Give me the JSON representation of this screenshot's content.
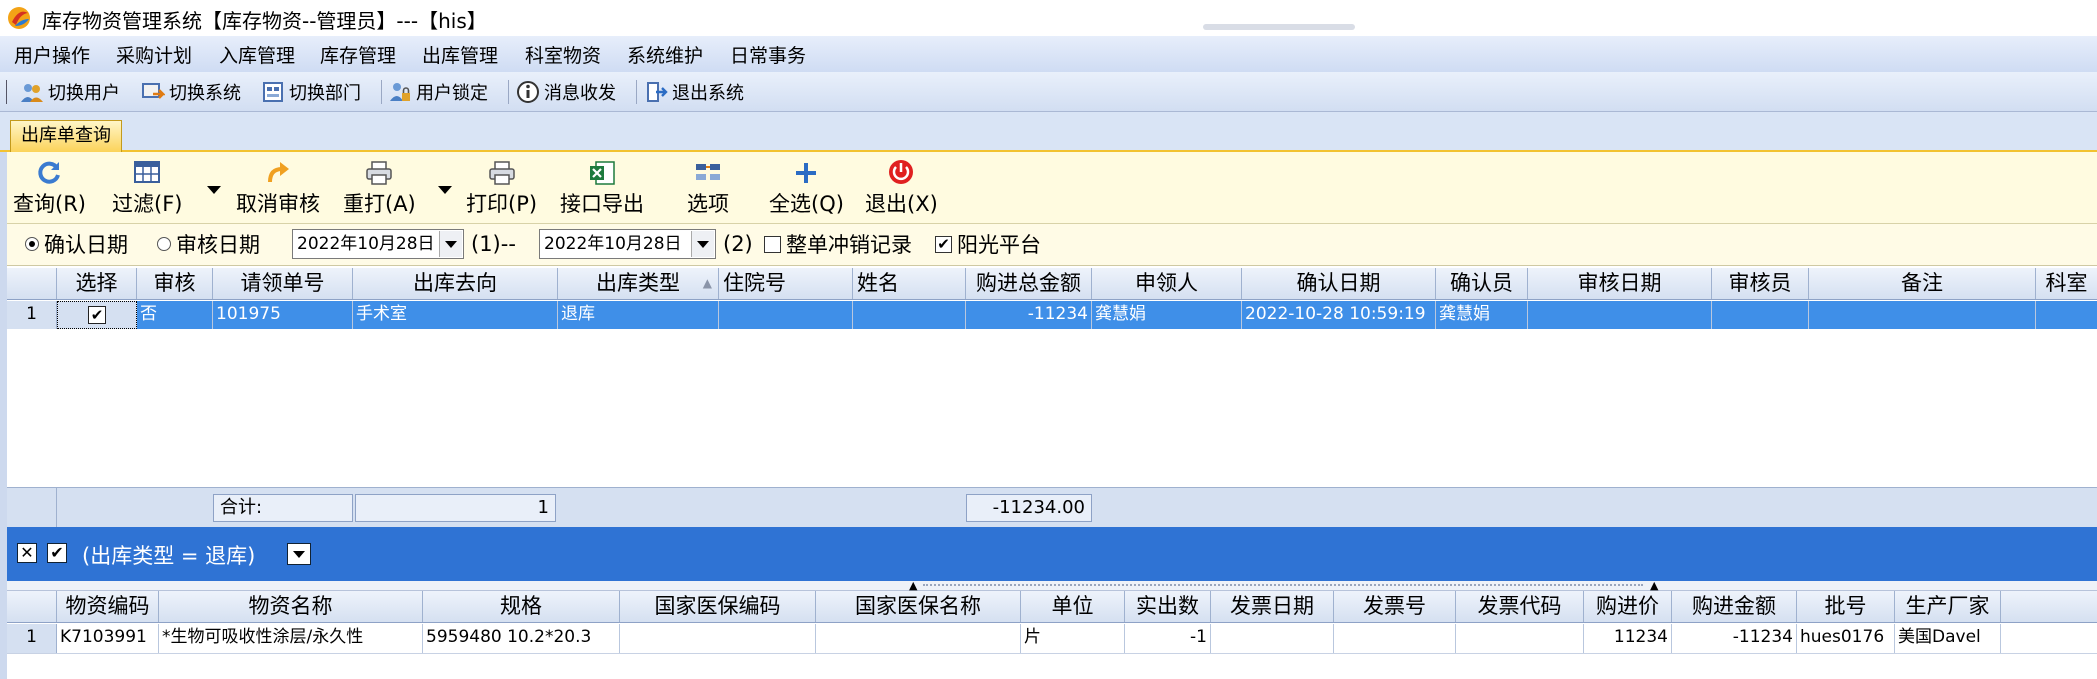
{
  "window": {
    "title": "库存物资管理系统【库存物资--管理员】---【his】"
  },
  "menu": [
    "用户操作",
    "采购计划",
    "入库管理",
    "库存管理",
    "出库管理",
    "科室物资",
    "系统维护",
    "日常事务"
  ],
  "toolbar": [
    "切换用户",
    "切换系统",
    "切换部门",
    "用户锁定",
    "消息收发",
    "退出系统"
  ],
  "tab": {
    "label": "出库单查询"
  },
  "actions": {
    "query": "查询(R)",
    "filter": "过滤(F)",
    "cancel_audit": "取消审核",
    "reprint": "重打(A)",
    "print": "打印(P)",
    "export": "接口导出",
    "options": "选项",
    "select_all": "全选(Q)",
    "exit": "退出(X)"
  },
  "filter": {
    "confirm_date": "确认日期",
    "audit_date": "审核日期",
    "date1": "2022年10月28日",
    "label1": "(1)--",
    "date2": "2022年10月28日",
    "label2": "(2)",
    "offset_records": "整单冲销记录",
    "sunshine": "阳光平台"
  },
  "grid1": {
    "columns": [
      "选择",
      "审核",
      "请领单号",
      "出库去向",
      "出库类型",
      "住院号",
      "姓名",
      "购进总金额",
      "申领人",
      "确认日期",
      "确认员",
      "审核日期",
      "审核员",
      "备注",
      "科室"
    ],
    "rows": [
      {
        "num": "1",
        "audit": "否",
        "req_no": "101975",
        "dest": "手术室",
        "type": "退库",
        "inpatient": "",
        "name": "",
        "amount": "-11234",
        "applicant": "龚慧娟",
        "confirm_date": "2022-10-28 10:59:19",
        "confirmer": "龚慧娟",
        "audit_date": "",
        "auditor": "",
        "note": "",
        "dept": ""
      }
    ],
    "footer": {
      "total_label": "合计:",
      "count": "1",
      "sum": "-11234.00"
    }
  },
  "group": {
    "filter_text": "(出库类型 = 退库)"
  },
  "grid2": {
    "columns": [
      "物资编码",
      "物资名称",
      "规格",
      "国家医保编码",
      "国家医保名称",
      "单位",
      "实出数",
      "发票日期",
      "发票号",
      "发票代码",
      "购进价",
      "购进金额",
      "批号",
      "生产厂家"
    ],
    "rows": [
      {
        "num": "1",
        "code": "K7103991",
        "name": "*生物可吸收性涂层/永久性",
        "spec": "5959480 10.2*20.3",
        "nhsa_code": "",
        "nhsa_name": "",
        "unit": "片",
        "qty": "-1",
        "inv_date": "",
        "inv_no": "",
        "inv_code": "",
        "price": "11234",
        "amount": "-11234",
        "batch": "hues0176",
        "maker": "美国Davel"
      }
    ]
  }
}
